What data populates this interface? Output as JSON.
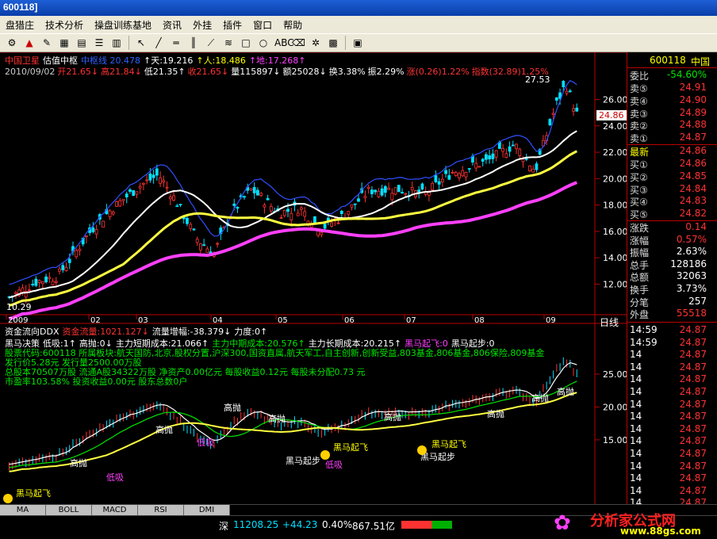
{
  "window": {
    "title": "600118]"
  },
  "menu": [
    "盘猎庄",
    "技术分析",
    "操盘训练基地",
    "资讯",
    "外挂",
    "插件",
    "窗口",
    "帮助"
  ],
  "header": {
    "line1": [
      {
        "text": "中国卫星",
        "color": "#ff3232"
      },
      {
        "text": "估值中枢",
        "color": "#ffffff"
      },
      {
        "text": "中枢线 20.478",
        "color": "#3060ff"
      },
      {
        "text": "↑天:19.216",
        "color": "#ffffff"
      },
      {
        "text": "↑人:18.486",
        "color": "#ffff00"
      },
      {
        "text": "↑地:17.268↑",
        "color": "#ff40ff"
      }
    ],
    "line2": [
      {
        "text": "2010/09/02",
        "color": "#cccccc"
      },
      {
        "text": "开21.65↓",
        "color": "#ff3232"
      },
      {
        "text": "高21.84↓",
        "color": "#ff3232"
      },
      {
        "text": "低21.35↑",
        "color": "#ffffff"
      },
      {
        "text": "收21.65↓",
        "color": "#ff3232"
      },
      {
        "text": "量115897↓",
        "color": "#ffffff"
      },
      {
        "text": "额25028↓",
        "color": "#ffffff"
      },
      {
        "text": "换3.38%",
        "color": "#ffffff"
      },
      {
        "text": "振2.29%",
        "color": "#ffffff"
      },
      {
        "text": "涨(0.26)1.22%",
        "color": "#ff3232"
      },
      {
        "text": "指数(32.89)1.25%",
        "color": "#ff3232"
      }
    ],
    "peak_label": "27.53",
    "low_label": "10.29",
    "current_price_tag": "24.86"
  },
  "price_axis": [
    "26.00",
    "24.00",
    "22.00",
    "20.00",
    "18.00",
    "16.00",
    "14.00",
    "12.00"
  ],
  "time_axis": [
    "2009",
    "02",
    "03",
    "04",
    "05",
    "06",
    "07",
    "08",
    "09"
  ],
  "time_axis_right": "日线",
  "ddx": [
    {
      "text": "资金流向DDX",
      "color": "#ffffff"
    },
    {
      "text": "资金流量:1021.127↓",
      "color": "#ff3232"
    },
    {
      "text": "流量增幅:-38.379↓",
      "color": "#ffffff"
    },
    {
      "text": "力度:0↑",
      "color": "#ffffff"
    }
  ],
  "heima": [
    {
      "text": "黑马决策",
      "color": "#ffffff"
    },
    {
      "text": "低吸:1↑",
      "color": "#ffffff"
    },
    {
      "text": "高抛:0↓",
      "color": "#ffffff"
    },
    {
      "text": "主力短期成本:21.066↑",
      "color": "#ffffff"
    },
    {
      "text": "主力中期成本:20.576↑",
      "color": "#00e600"
    },
    {
      "text": "主力长期成本:20.215↑",
      "color": "#ffffff"
    },
    {
      "text": "黑马起飞:0",
      "color": "#ff40ff"
    },
    {
      "text": "黑马起步:0",
      "color": "#ffffff"
    }
  ],
  "info": [
    "股票代码:600118  所属板块:航天国防,北京,股权分置,沪深300,国资直属,航天军工,自主创新,创新受益,803基金,806基金,806保险,809基金",
    "发行价5.28元   发行量2500.00万股",
    "总股本70507万股   流通A股34322万股   净资产0.00亿元   每股收益0.12元   每股未分配0.73 元",
    "市盈率103.58%   投资收益0.00元   股东总数0户"
  ],
  "lower_axis": [
    "25.00",
    "20.00",
    "15.00"
  ],
  "annotations": {
    "gaopao": "高抛",
    "dixi": "低吸",
    "qifei": "黑马起飞",
    "qibu": "黑马起步"
  },
  "quote": {
    "code": "600118",
    "name": "中国",
    "weibi_label": "委比",
    "weibi_value": "-54.60%",
    "sells": [
      {
        "label": "卖⑤",
        "price": "24.91"
      },
      {
        "label": "卖④",
        "price": "24.90"
      },
      {
        "label": "卖③",
        "price": "24.89"
      },
      {
        "label": "卖②",
        "price": "24.88"
      },
      {
        "label": "卖①",
        "price": "24.87"
      }
    ],
    "latest_label": "最新",
    "latest": "24.86",
    "buys": [
      {
        "label": "买①",
        "price": "24.86"
      },
      {
        "label": "买②",
        "price": "24.85"
      },
      {
        "label": "买③",
        "price": "24.84"
      },
      {
        "label": "买④",
        "price": "24.83"
      },
      {
        "label": "买⑤",
        "price": "24.82"
      }
    ],
    "stats": [
      {
        "label": "涨跌",
        "value": "0.14",
        "color": "#ff3232"
      },
      {
        "label": "涨幅",
        "value": "0.57%",
        "color": "#ff3232"
      },
      {
        "label": "振幅",
        "value": "2.63%",
        "color": "#ffffff"
      },
      {
        "label": "总手",
        "value": "128186",
        "color": "#ffffff"
      },
      {
        "label": "总额",
        "value": "32063",
        "color": "#ffffff"
      },
      {
        "label": "换手",
        "value": "3.73%",
        "color": "#ffffff"
      },
      {
        "label": "分笔",
        "value": "257",
        "color": "#ffffff"
      },
      {
        "label": "外盘",
        "value": "55518",
        "color": "#ff3232"
      }
    ],
    "ticks": [
      {
        "time": "14:59",
        "price": "24.87"
      },
      {
        "time": "14:59",
        "price": "24.87"
      },
      {
        "time": "14",
        "price": "24.87"
      },
      {
        "time": "14",
        "price": "24.87"
      },
      {
        "time": "14",
        "price": "24.87"
      },
      {
        "time": "14",
        "price": "24.87"
      },
      {
        "time": "14",
        "price": "24.87"
      },
      {
        "time": "14",
        "price": "24.87"
      },
      {
        "time": "14",
        "price": "24.87"
      },
      {
        "time": "14",
        "price": "24.87"
      },
      {
        "time": "14",
        "price": "24.87"
      },
      {
        "time": "14",
        "price": "24.87"
      },
      {
        "time": "14",
        "price": "24.87"
      },
      {
        "time": "14",
        "price": "24.87"
      },
      {
        "time": "14",
        "price": "24.87"
      }
    ]
  },
  "tabs": [
    "MA",
    "BOLL",
    "MACD",
    "RSI",
    "DMI"
  ],
  "status": {
    "market": "深",
    "index": "11208.25",
    "change": "+44.23",
    "pct": "0.40%",
    "amount": "867.51亿",
    "logo_text": "分析家公式网",
    "logo_url": "www.88gs.com"
  }
}
